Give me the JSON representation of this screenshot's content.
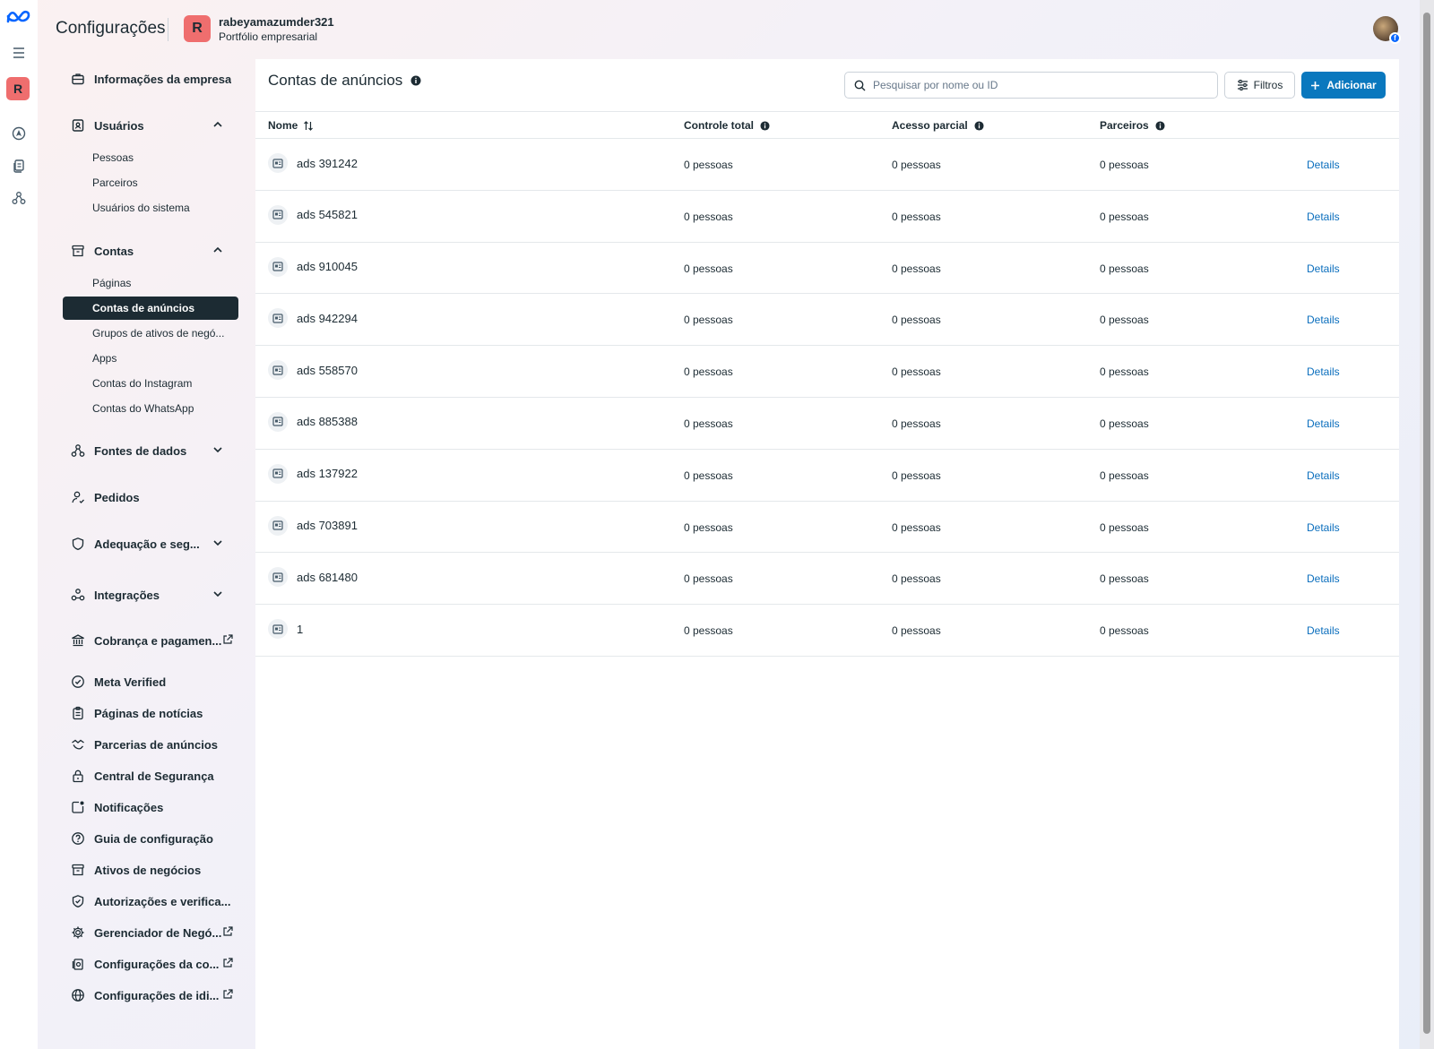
{
  "header": {
    "title": "Configurações",
    "account_initial": "R",
    "account_name": "rabeyamazumder321",
    "account_type": "Portfólio empresarial"
  },
  "rail": {
    "badge": "R"
  },
  "sidebar": {
    "company_info": "Informações da empresa",
    "users": {
      "label": "Usuários",
      "items": [
        "Pessoas",
        "Parceiros",
        "Usuários do sistema"
      ]
    },
    "accounts": {
      "label": "Contas",
      "items": [
        "Páginas",
        "Contas de anúncios",
        "Grupos de ativos de negó...",
        "Apps",
        "Contas do Instagram",
        "Contas do WhatsApp"
      ],
      "active_index": 1
    },
    "data_sources": "Fontes de dados",
    "requests": "Pedidos",
    "compliance": "Adequação e seg...",
    "integrations": "Integrações",
    "billing": "Cobrança e pagamen...",
    "meta_verified": "Meta Verified",
    "news_pages": "Páginas de notícias",
    "ad_partnerships": "Parcerias de anúncios",
    "security_center": "Central de Segurança",
    "notifications": "Notificações",
    "setup_guide": "Guia de configuração",
    "business_assets": "Ativos de negócios",
    "authorizations": "Autorizações e verifica...",
    "business_manager": "Gerenciador de Negó...",
    "account_settings": "Configurações da co...",
    "language_settings": "Configurações de idi..."
  },
  "main": {
    "title": "Contas de anúncios",
    "search_placeholder": "Pesquisar por nome ou ID",
    "filters_label": "Filtros",
    "add_label": "Adicionar",
    "columns": {
      "name": "Nome",
      "full_control": "Controle total",
      "partial_access": "Acesso parcial",
      "partners": "Parceiros"
    },
    "rows": [
      {
        "name": "ads 391242",
        "full": "0 pessoas",
        "partial": "0 pessoas",
        "partners": "0 pessoas",
        "action": "Details"
      },
      {
        "name": "ads 545821",
        "full": "0 pessoas",
        "partial": "0 pessoas",
        "partners": "0 pessoas",
        "action": "Details"
      },
      {
        "name": "ads 910045",
        "full": "0 pessoas",
        "partial": "0 pessoas",
        "partners": "0 pessoas",
        "action": "Details"
      },
      {
        "name": "ads 942294",
        "full": "0 pessoas",
        "partial": "0 pessoas",
        "partners": "0 pessoas",
        "action": "Details"
      },
      {
        "name": "ads 558570",
        "full": "0 pessoas",
        "partial": "0 pessoas",
        "partners": "0 pessoas",
        "action": "Details"
      },
      {
        "name": "ads 885388",
        "full": "0 pessoas",
        "partial": "0 pessoas",
        "partners": "0 pessoas",
        "action": "Details"
      },
      {
        "name": "ads 137922",
        "full": "0 pessoas",
        "partial": "0 pessoas",
        "partners": "0 pessoas",
        "action": "Details"
      },
      {
        "name": "ads 703891",
        "full": "0 pessoas",
        "partial": "0 pessoas",
        "partners": "0 pessoas",
        "action": "Details"
      },
      {
        "name": "ads 681480",
        "full": "0 pessoas",
        "partial": "0 pessoas",
        "partners": "0 pessoas",
        "action": "Details"
      },
      {
        "name": "1",
        "full": "0 pessoas",
        "partial": "0 pessoas",
        "partners": "0 pessoas",
        "action": "Details"
      }
    ]
  },
  "colors": {
    "primary_button": "#0a78be",
    "link": "#0a6ebd",
    "active_nav": "#1c2b33",
    "account_badge": "#ef6e6e"
  }
}
